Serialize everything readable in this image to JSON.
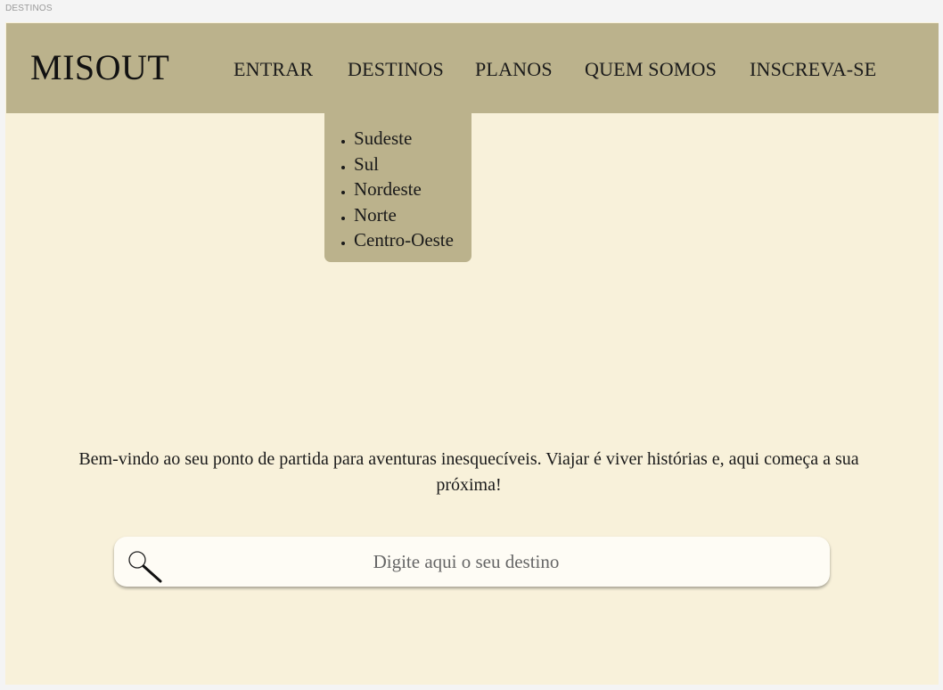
{
  "page_label": "DESTINOS",
  "brand": "MISOUT",
  "nav": {
    "entrar": "ENTRAR",
    "destinos": "DESTINOS",
    "planos": "PLANOS",
    "quem_somos": "QUEM SOMOS",
    "inscreva_se": "INSCREVA-SE"
  },
  "dropdown": {
    "items": [
      "Sudeste",
      "Sul",
      "Nordeste",
      "Norte",
      "Centro-Oeste"
    ]
  },
  "hero": {
    "welcome_text": "Bem-vindo ao seu ponto de partida para aventuras inesquecíveis. Viajar é viver histórias e, aqui começa a sua próxima!"
  },
  "search": {
    "placeholder": "Digite aqui o seu destino",
    "icon": "magnifier-icon"
  },
  "colors": {
    "navbar": "#bbb28c",
    "background": "#f8f1da",
    "search_box": "#fefcf5"
  }
}
